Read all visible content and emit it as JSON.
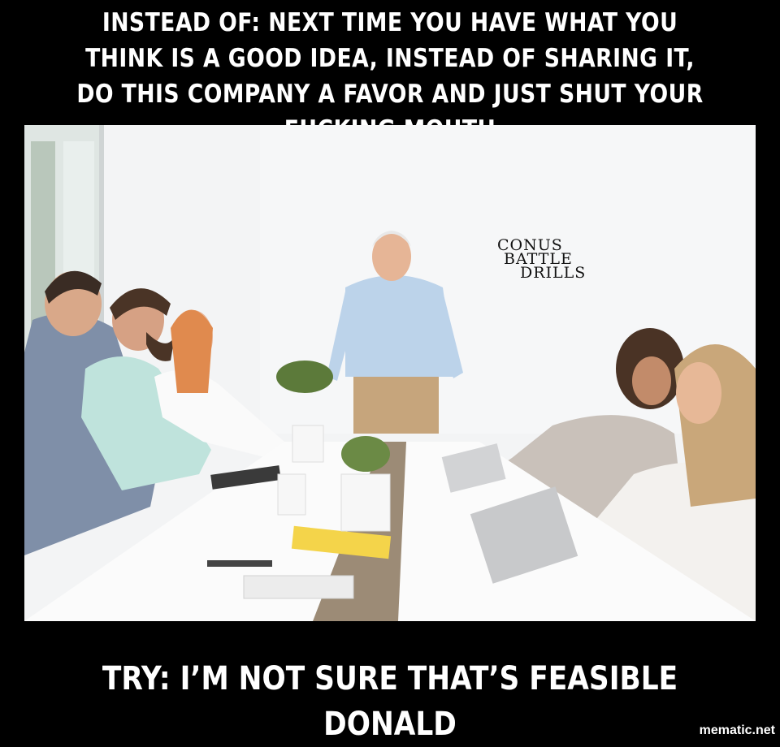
{
  "meme": {
    "top_caption": "INSTEAD OF: NEXT TIME YOU HAVE WHAT YOU THINK IS A GOOD IDEA, INSTEAD OF SHARING IT, DO THIS COMPANY A FAVOR AND JUST SHUT YOUR FUCKING MOUTH",
    "bottom_caption": "TRY: I’M NOT SURE THAT’S FEASIBLE DONALD",
    "credit": "mematic.net"
  },
  "watermark": {
    "line1": "CONUS",
    "line2": "BATTLE",
    "line3": "DRILLS"
  },
  "photo": {
    "scene": "office meeting around a white conference table",
    "colors": {
      "background": "#000000",
      "caption_text": "#ffffff",
      "wall": "#f4f5f6",
      "table": "#fbfbfb"
    }
  }
}
